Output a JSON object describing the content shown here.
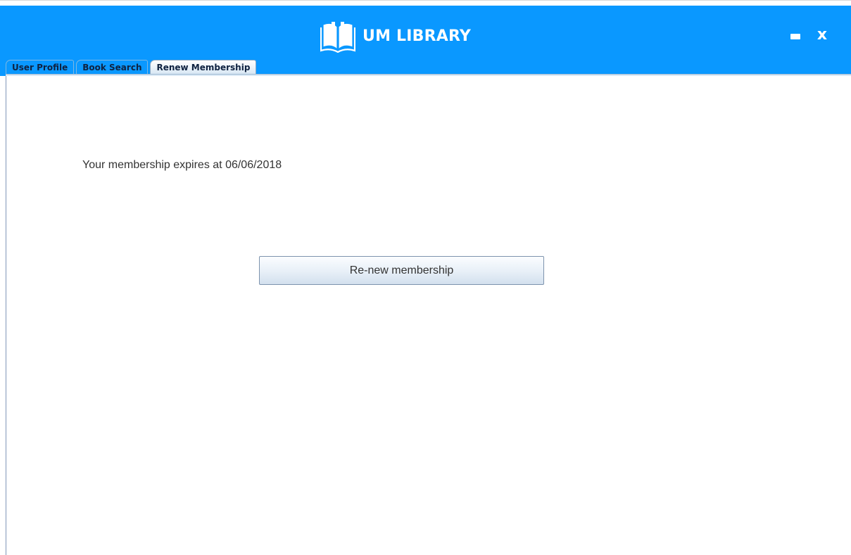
{
  "app": {
    "title": "UM LIBRARY",
    "logo_icon": "open-book-icon",
    "header_color": "#0a98ff"
  },
  "window_controls": {
    "close_label": "x"
  },
  "tabs": [
    {
      "label": "User Profile",
      "active": false
    },
    {
      "label": "Book Search",
      "active": false
    },
    {
      "label": "Renew Membership",
      "active": true
    }
  ],
  "membership": {
    "expiry_message": "Your membership expires at 06/06/2018",
    "renew_button_label": "Re-new membership"
  }
}
